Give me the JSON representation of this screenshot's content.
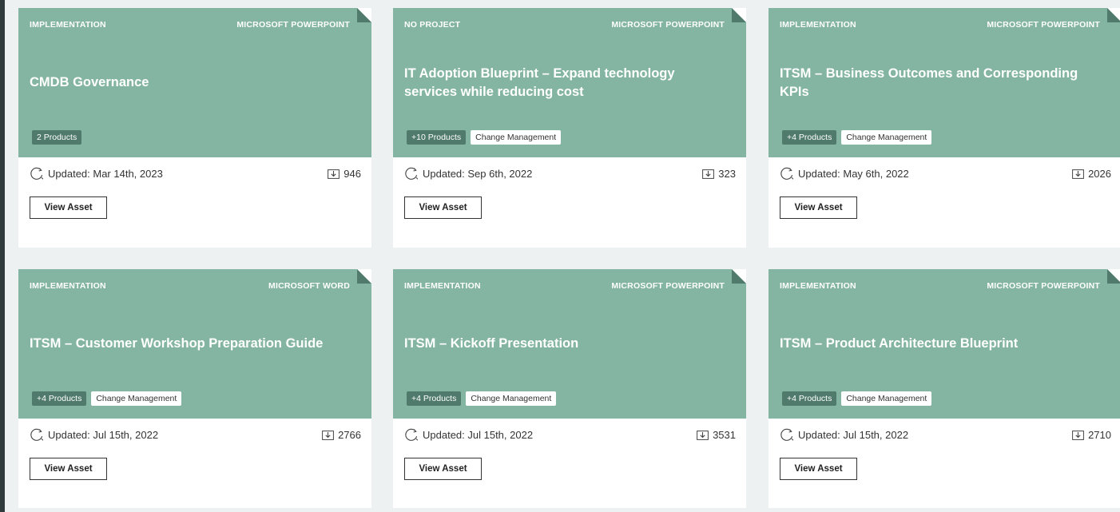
{
  "labels": {
    "view_asset": "View Asset"
  },
  "cards": [
    {
      "project": "IMPLEMENTATION",
      "format": "MICROSOFT POWERPOINT",
      "title": "CMDB Governance",
      "products_tag": "2 Products",
      "category_tag": "",
      "updated": "Updated: Mar 14th, 2023",
      "downloads": "946"
    },
    {
      "project": "NO PROJECT",
      "format": "MICROSOFT POWERPOINT",
      "title": "IT Adoption Blueprint – Expand technology services while reducing cost",
      "products_tag": "+10 Products",
      "category_tag": "Change Management",
      "updated": "Updated: Sep 6th, 2022",
      "downloads": "323"
    },
    {
      "project": "IMPLEMENTATION",
      "format": "MICROSOFT POWERPOINT",
      "title": "ITSM – Business Outcomes and Corresponding KPIs",
      "products_tag": "+4 Products",
      "category_tag": "Change Management",
      "updated": "Updated: May 6th, 2022",
      "downloads": "2026"
    },
    {
      "project": "IMPLEMENTATION",
      "format": "MICROSOFT WORD",
      "title": "ITSM – Customer Workshop Preparation Guide",
      "products_tag": "+4 Products",
      "category_tag": "Change Management",
      "updated": "Updated: Jul 15th, 2022",
      "downloads": "2766"
    },
    {
      "project": "IMPLEMENTATION",
      "format": "MICROSOFT POWERPOINT",
      "title": "ITSM – Kickoff Presentation",
      "products_tag": "+4 Products",
      "category_tag": "Change Management",
      "updated": "Updated: Jul 15th, 2022",
      "downloads": "3531"
    },
    {
      "project": "IMPLEMENTATION",
      "format": "MICROSOFT POWERPOINT",
      "title": "ITSM – Product Architecture Blueprint",
      "products_tag": "+4 Products",
      "category_tag": "Change Management",
      "updated": "Updated: Jul 15th, 2022",
      "downloads": "2710"
    }
  ],
  "colors": {
    "card_accent": "#84b5a3",
    "tag_dark": "#4f7a6c",
    "page_background": "#eef1f1"
  },
  "icons": {
    "updated": "refresh-icon",
    "downloads": "download-icon"
  }
}
